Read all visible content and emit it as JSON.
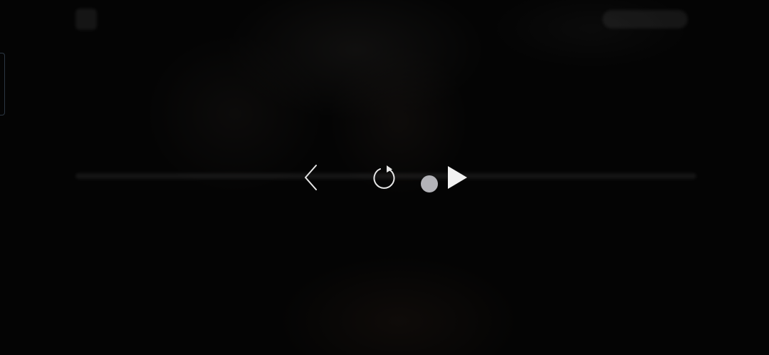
{
  "player": {
    "state": "paused",
    "controls_visible": true,
    "background_blurred": true
  },
  "icons": {
    "top_left": "back-icon",
    "previous": "chevron-left-icon",
    "replay": "replay-icon",
    "play": "play-icon"
  },
  "colors": {
    "background": "#060606",
    "icon": "#e6e6e6",
    "scrub_thumb": "#b3b3b8"
  }
}
